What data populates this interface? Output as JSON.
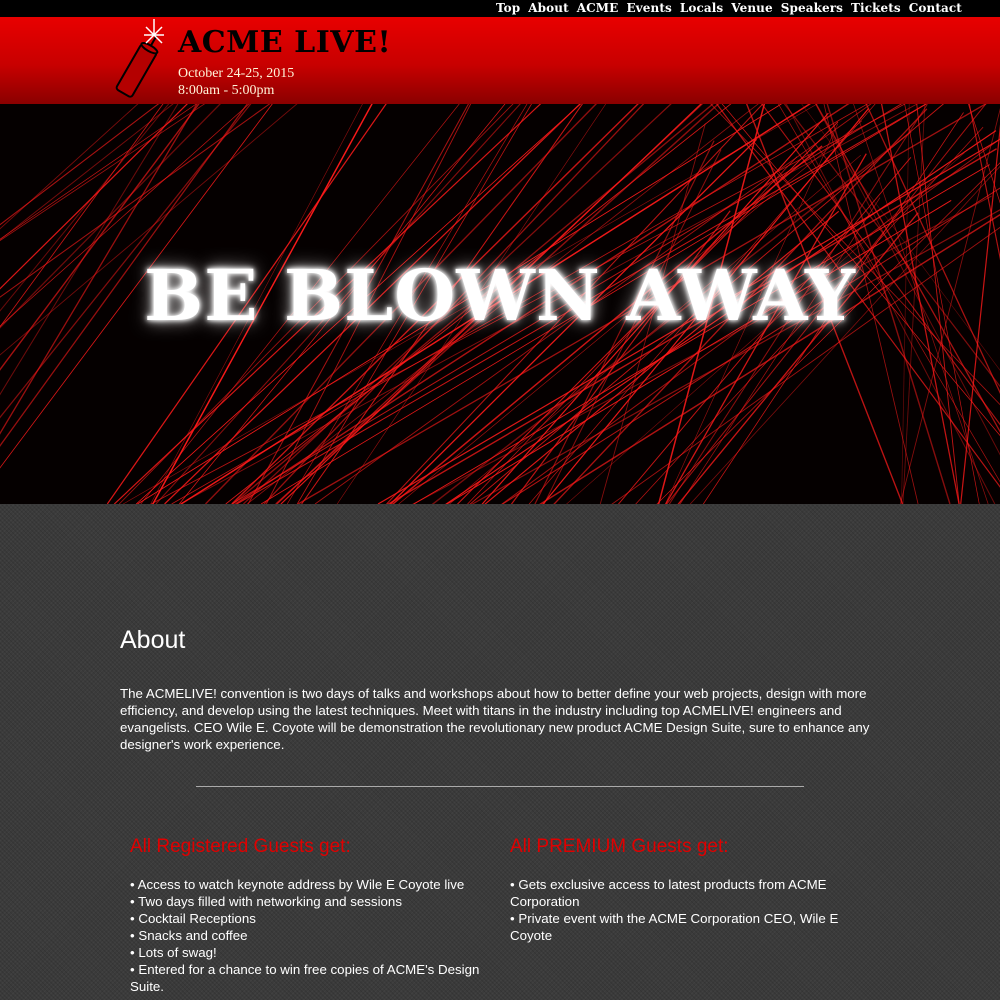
{
  "nav": {
    "items": [
      "Top",
      "About",
      "ACME",
      "Events",
      "Locals",
      "Venue",
      "Speakers",
      "Tickets",
      "Contact"
    ]
  },
  "header": {
    "title": "ACME LIVE!",
    "date_line": "October 24-25, 2015",
    "time_line": "8:00am - 5:00pm"
  },
  "hero": {
    "headline": "BE BLOWN AWAY"
  },
  "about": {
    "title": "About",
    "body": "The ACMELIVE! convention is two days of talks and workshops about how to better define your web projects, design with more efficiency, and develop using the latest techniques. Meet with titans in the industry including top ACMELIVE! engineers and evangelists. CEO Wile E. Coyote will be demonstration the revolutionary new product ACME Design Suite, sure to enhance any designer's work experience."
  },
  "registered": {
    "title": "All Registered Guests get:",
    "items": [
      "Access to watch keynote address by Wile E Coyote live",
      "Two days filled with networking and sessions",
      "Cocktail Receptions",
      "Snacks and coffee",
      "Lots of swag!",
      "Entered for a chance to win free copies of ACME's Design Suite."
    ]
  },
  "premium": {
    "title": "All PREMIUM Guests get:",
    "items": [
      "Gets exclusive access to latest products from ACME Corporation",
      "Private event with the ACME Corporation CEO, Wile E Coyote"
    ]
  },
  "colors": {
    "header_red": "#e00000",
    "accent_red": "#e00000",
    "content_bg": "#3b3b3b"
  }
}
